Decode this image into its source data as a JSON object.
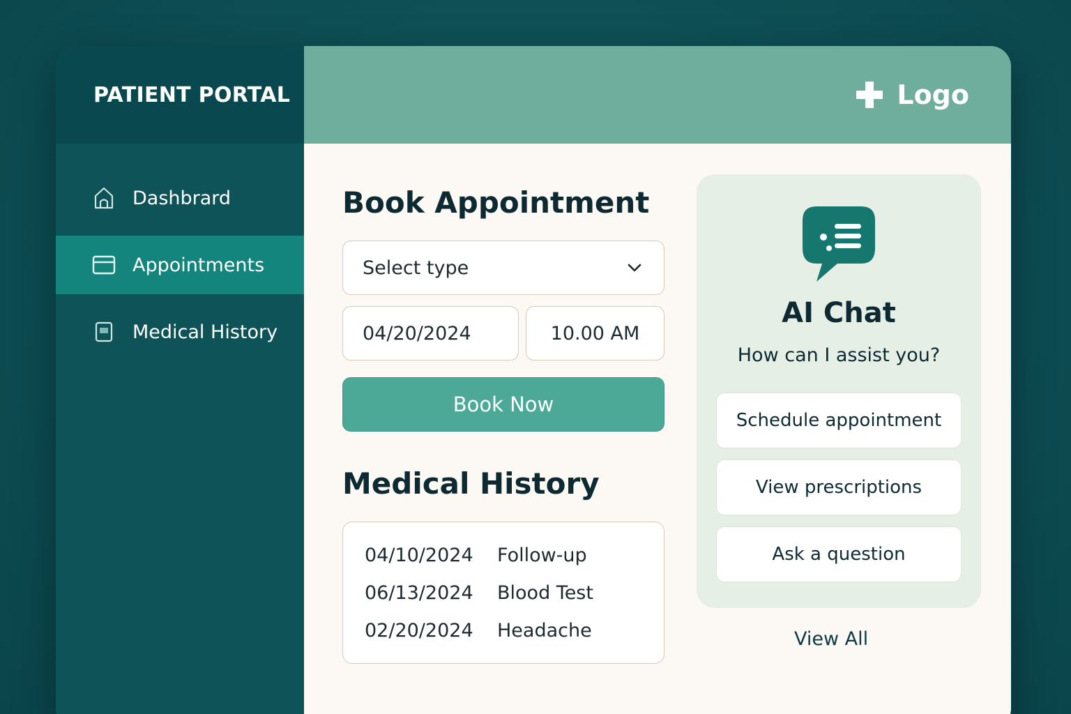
{
  "sidebar": {
    "title": "PATIENT PORTAL",
    "items": [
      {
        "label": "Dashbrard",
        "icon": "home-icon",
        "active": false
      },
      {
        "label": "Appointments",
        "icon": "calendar-icon",
        "active": true
      },
      {
        "label": "Medical History",
        "icon": "document-icon",
        "active": false
      }
    ]
  },
  "header": {
    "logo_text": "Logo",
    "logo_icon": "medical-cross-icon"
  },
  "book": {
    "title": "Book Appointment",
    "select_value": "Select type",
    "date_value": "04/20/2024",
    "time_value": "10.00 AM",
    "button_label": "Book Now"
  },
  "history": {
    "title": "Medical History",
    "rows": [
      {
        "date": "04/10/2024",
        "event": "Follow-up"
      },
      {
        "date": "06/13/2024",
        "event": "Blood Test"
      },
      {
        "date": "02/20/2024",
        "event": "Headache"
      }
    ]
  },
  "chat": {
    "icon": "chat-bubble-icon",
    "title": "AI Chat",
    "subtitle": "How can I assist you?",
    "options": [
      "Schedule appointment",
      "View prescriptions",
      "Ask a question"
    ],
    "view_all": "View All"
  },
  "colors": {
    "page_bg": "#0c4f55",
    "sidebar_bg": "#0d5358",
    "sidebar_active": "#13857c",
    "header_bg": "#6fae9c",
    "primary_button": "#4ca998",
    "content_bg": "#fcf8f3",
    "chat_card_bg": "#e6efe6",
    "chat_icon": "#15776e",
    "text_dark": "#0d2a33"
  }
}
